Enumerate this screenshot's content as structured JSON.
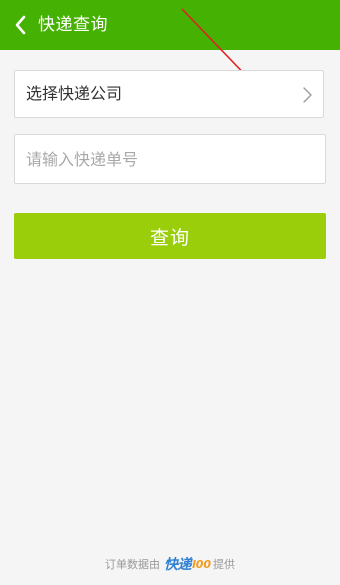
{
  "header": {
    "title": "快递查询",
    "back_icon": "chevron-left-icon"
  },
  "form": {
    "company_select_label": "选择快递公司",
    "company_select_icon": "chevron-right-icon",
    "tracking_placeholder": "请输入快递单号",
    "query_button_label": "查询"
  },
  "footer": {
    "prefix": "订单数据由",
    "brand_main": "快递",
    "brand_suffix": "l00",
    "suffix": "提供"
  },
  "colors": {
    "header_bg": "#45b103",
    "button_bg": "#9acd0a",
    "annotation_arrow": "#e02020",
    "brand_blue": "#2f7fd2",
    "brand_orange": "#f39a1e"
  }
}
